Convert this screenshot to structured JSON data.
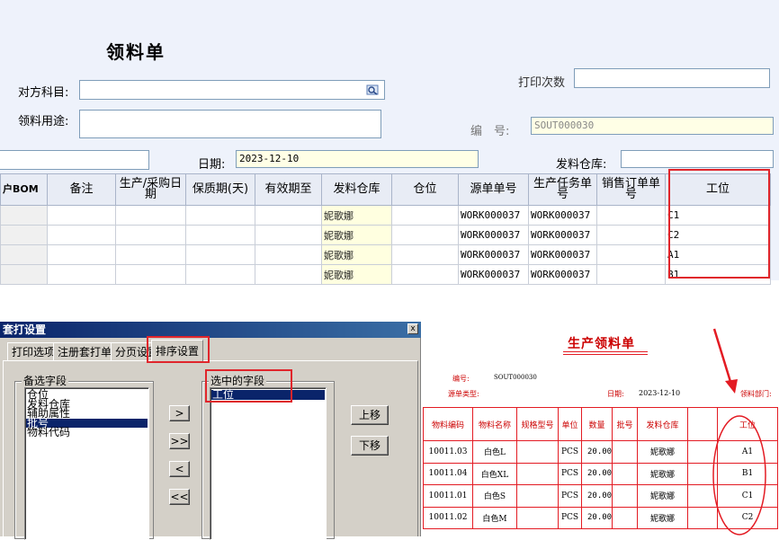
{
  "form": {
    "title": "领料单",
    "counterparty_label": "对方科目:",
    "purpose_label": "领料用途:",
    "print_count_label": "打印次数",
    "number_label": "编　号:",
    "number_value": "SOUT000030",
    "date_label": "日期:",
    "date_value": "2023-12-10",
    "warehouse_label": "发料仓库:",
    "grid": {
      "headers": [
        "户BOM",
        "备注",
        "生产/采购日期",
        "保质期(天)",
        "有效期至",
        "发料仓库",
        "仓位",
        "源单单号",
        "生产任务单号",
        "销售订单单号",
        "工位"
      ],
      "rows": [
        [
          "",
          "",
          "",
          "",
          "",
          "妮歌娜",
          "",
          "WORK000037",
          "WORK000037",
          "",
          "C1"
        ],
        [
          "",
          "",
          "",
          "",
          "",
          "妮歌娜",
          "",
          "WORK000037",
          "WORK000037",
          "",
          "C2"
        ],
        [
          "",
          "",
          "",
          "",
          "",
          "妮歌娜",
          "",
          "WORK000037",
          "WORK000037",
          "",
          "A1"
        ],
        [
          "",
          "",
          "",
          "",
          "",
          "妮歌娜",
          "",
          "WORK000037",
          "WORK000037",
          "",
          "B1"
        ]
      ]
    }
  },
  "dialog": {
    "title": "套打设置",
    "close_glyph": "x",
    "tabs": [
      "打印选项",
      "注册套打单据",
      "分页设置",
      "排序设置"
    ],
    "active_tab": 3,
    "available_label": "备选字段",
    "available_fields": [
      "仓位",
      "发料仓库",
      "辅助属性",
      "批号",
      "物料代码"
    ],
    "available_selected": 3,
    "selected_label": "选中的字段",
    "selected_fields": [
      "工位"
    ],
    "btn_add": ">",
    "btn_add_all": ">>",
    "btn_remove": "<",
    "btn_remove_all": "<<",
    "btn_up": "上移",
    "btn_down": "下移"
  },
  "preview": {
    "title": "生产领料单",
    "number_label": "编号:",
    "number_value": "SOUT000030",
    "source_type_label": "源单类型:",
    "date_label": "日期:",
    "date_value": "2023-12-10",
    "dept_label": "领料部门:",
    "headers": [
      "物料编码",
      "物料名称",
      "规格型号",
      "单位",
      "数量",
      "批号",
      "发料仓库",
      "",
      "工位"
    ],
    "rows": [
      [
        "10011.03",
        "白色L",
        "",
        "PCS",
        "20.00",
        "",
        "妮歌娜",
        "",
        "A1"
      ],
      [
        "10011.04",
        "白色XL",
        "",
        "PCS",
        "20.00",
        "",
        "妮歌娜",
        "",
        "B1"
      ],
      [
        "10011.01",
        "白色S",
        "",
        "PCS",
        "20.00",
        "",
        "妮歌娜",
        "",
        "C1"
      ],
      [
        "10011.02",
        "白色M",
        "",
        "PCS",
        "20.00",
        "",
        "妮歌娜",
        "",
        "C2"
      ]
    ]
  },
  "colors": {
    "highlight": "#e0252b",
    "selection": "#0a246a"
  }
}
